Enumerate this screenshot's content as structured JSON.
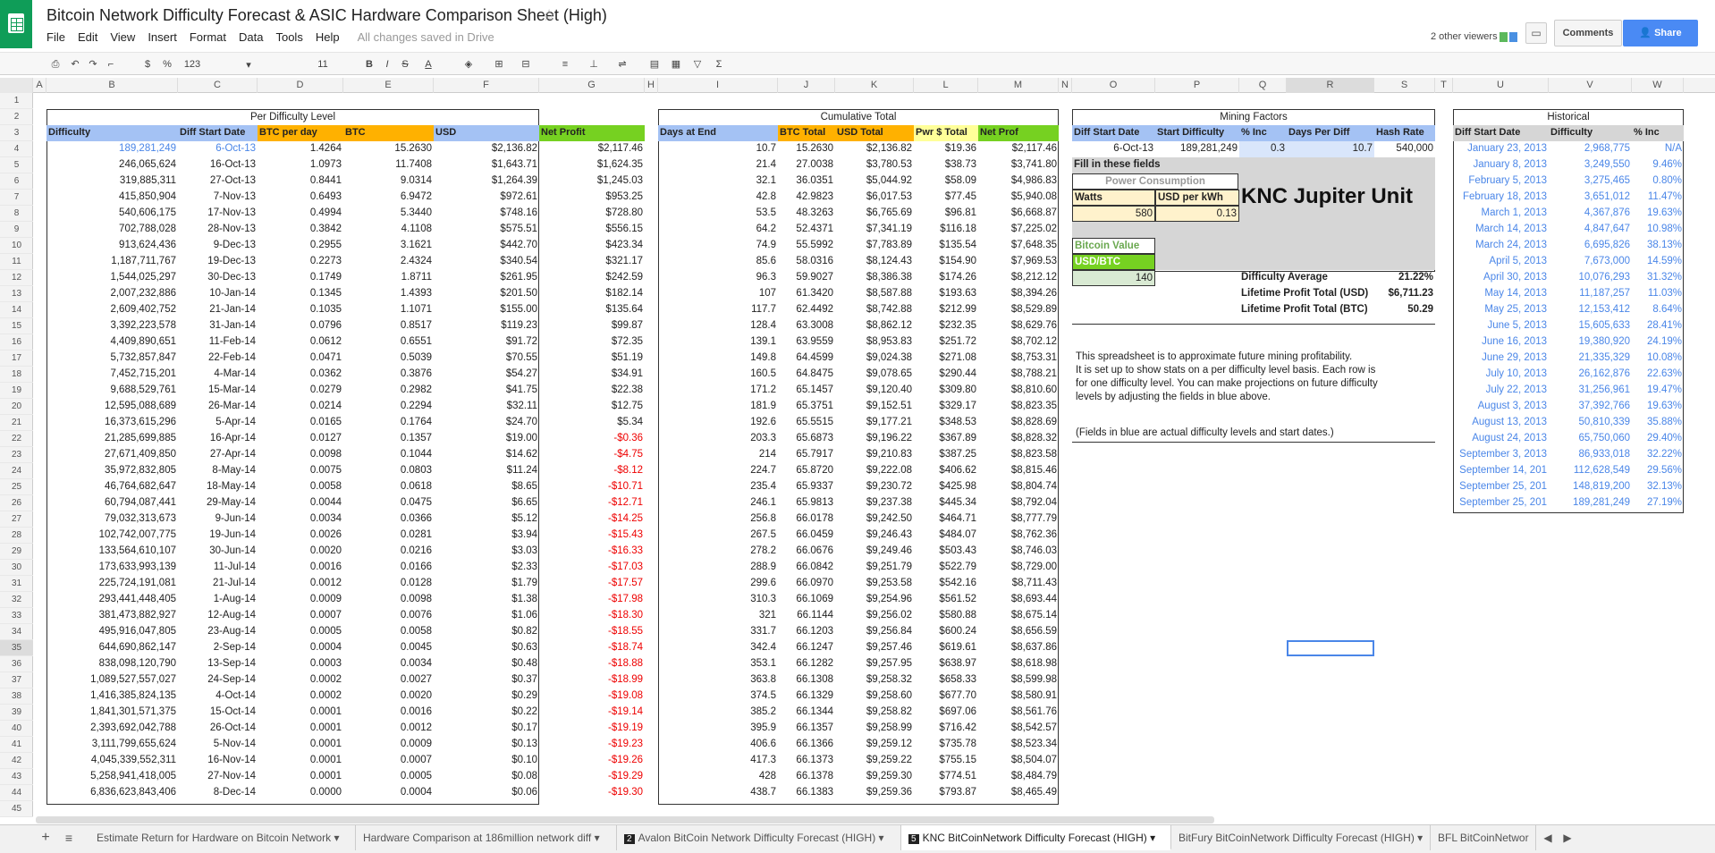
{
  "title": "Bitcoin Network Difficulty Forecast & ASIC Hardware Comparison Sheet (High)",
  "menu": [
    "File",
    "Edit",
    "View",
    "Insert",
    "Format",
    "Data",
    "Tools",
    "Help"
  ],
  "saved": "All changes saved in Drive",
  "viewers": "2 other viewers",
  "comments": "Comments",
  "share": "Share",
  "toolbar": {
    "currency": "$",
    "percent": "%",
    "numfmt": "123",
    "fontsize": "11"
  },
  "columns": [
    "A",
    "B",
    "C",
    "D",
    "E",
    "F",
    "G",
    "H",
    "I",
    "J",
    "K",
    "L",
    "M",
    "N",
    "O",
    "P",
    "Q",
    "R",
    "S",
    "T",
    "U",
    "V",
    "W"
  ],
  "section_titles": {
    "per": "Per Difficulty Level",
    "cum": "Cumulative Total",
    "mining": "Mining Factors",
    "hist": "Historical"
  },
  "per_headers": [
    "Difficulty",
    "Diff Start Date",
    "BTC per day",
    "BTC",
    "USD",
    "Net Profit"
  ],
  "cum_headers": [
    "Days at End",
    "BTC Total",
    "USD Total",
    "Pwr $ Total",
    "Net Prof"
  ],
  "rows": [
    [
      "189,281,249",
      "6-Oct-13",
      "1.4264",
      "15.2630",
      "$2,136.82",
      "$2,117.46",
      "10.7",
      "15.2630",
      "$2,136.82",
      "$19.36",
      "$2,117.46"
    ],
    [
      "246,065,624",
      "16-Oct-13",
      "1.0973",
      "11.7408",
      "$1,643.71",
      "$1,624.35",
      "21.4",
      "27.0038",
      "$3,780.53",
      "$38.73",
      "$3,741.80"
    ],
    [
      "319,885,311",
      "27-Oct-13",
      "0.8441",
      "9.0314",
      "$1,264.39",
      "$1,245.03",
      "32.1",
      "36.0351",
      "$5,044.92",
      "$58.09",
      "$4,986.83"
    ],
    [
      "415,850,904",
      "7-Nov-13",
      "0.6493",
      "6.9472",
      "$972.61",
      "$953.25",
      "42.8",
      "42.9823",
      "$6,017.53",
      "$77.45",
      "$5,940.08"
    ],
    [
      "540,606,175",
      "17-Nov-13",
      "0.4994",
      "5.3440",
      "$748.16",
      "$728.80",
      "53.5",
      "48.3263",
      "$6,765.69",
      "$96.81",
      "$6,668.87"
    ],
    [
      "702,788,028",
      "28-Nov-13",
      "0.3842",
      "4.1108",
      "$575.51",
      "$556.15",
      "64.2",
      "52.4371",
      "$7,341.19",
      "$116.18",
      "$7,225.02"
    ],
    [
      "913,624,436",
      "9-Dec-13",
      "0.2955",
      "3.1621",
      "$442.70",
      "$423.34",
      "74.9",
      "55.5992",
      "$7,783.89",
      "$135.54",
      "$7,648.35"
    ],
    [
      "1,187,711,767",
      "19-Dec-13",
      "0.2273",
      "2.4324",
      "$340.54",
      "$321.17",
      "85.6",
      "58.0316",
      "$8,124.43",
      "$154.90",
      "$7,969.53"
    ],
    [
      "1,544,025,297",
      "30-Dec-13",
      "0.1749",
      "1.8711",
      "$261.95",
      "$242.59",
      "96.3",
      "59.9027",
      "$8,386.38",
      "$174.26",
      "$8,212.12"
    ],
    [
      "2,007,232,886",
      "10-Jan-14",
      "0.1345",
      "1.4393",
      "$201.50",
      "$182.14",
      "107",
      "61.3420",
      "$8,587.88",
      "$193.63",
      "$8,394.26"
    ],
    [
      "2,609,402,752",
      "21-Jan-14",
      "0.1035",
      "1.1071",
      "$155.00",
      "$135.64",
      "117.7",
      "62.4492",
      "$8,742.88",
      "$212.99",
      "$8,529.89"
    ],
    [
      "3,392,223,578",
      "31-Jan-14",
      "0.0796",
      "0.8517",
      "$119.23",
      "$99.87",
      "128.4",
      "63.3008",
      "$8,862.12",
      "$232.35",
      "$8,629.76"
    ],
    [
      "4,409,890,651",
      "11-Feb-14",
      "0.0612",
      "0.6551",
      "$91.72",
      "$72.35",
      "139.1",
      "63.9559",
      "$8,953.83",
      "$251.72",
      "$8,702.12"
    ],
    [
      "5,732,857,847",
      "22-Feb-14",
      "0.0471",
      "0.5039",
      "$70.55",
      "$51.19",
      "149.8",
      "64.4599",
      "$9,024.38",
      "$271.08",
      "$8,753.31"
    ],
    [
      "7,452,715,201",
      "4-Mar-14",
      "0.0362",
      "0.3876",
      "$54.27",
      "$34.91",
      "160.5",
      "64.8475",
      "$9,078.65",
      "$290.44",
      "$8,788.21"
    ],
    [
      "9,688,529,761",
      "15-Mar-14",
      "0.0279",
      "0.2982",
      "$41.75",
      "$22.38",
      "171.2",
      "65.1457",
      "$9,120.40",
      "$309.80",
      "$8,810.60"
    ],
    [
      "12,595,088,689",
      "26-Mar-14",
      "0.0214",
      "0.2294",
      "$32.11",
      "$12.75",
      "181.9",
      "65.3751",
      "$9,152.51",
      "$329.17",
      "$8,823.35"
    ],
    [
      "16,373,615,296",
      "5-Apr-14",
      "0.0165",
      "0.1764",
      "$24.70",
      "$5.34",
      "192.6",
      "65.5515",
      "$9,177.21",
      "$348.53",
      "$8,828.69"
    ],
    [
      "21,285,699,885",
      "16-Apr-14",
      "0.0127",
      "0.1357",
      "$19.00",
      "-$0.36",
      "203.3",
      "65.6873",
      "$9,196.22",
      "$367.89",
      "$8,828.32"
    ],
    [
      "27,671,409,850",
      "27-Apr-14",
      "0.0098",
      "0.1044",
      "$14.62",
      "-$4.75",
      "214",
      "65.7917",
      "$9,210.83",
      "$387.25",
      "$8,823.58"
    ],
    [
      "35,972,832,805",
      "8-May-14",
      "0.0075",
      "0.0803",
      "$11.24",
      "-$8.12",
      "224.7",
      "65.8720",
      "$9,222.08",
      "$406.62",
      "$8,815.46"
    ],
    [
      "46,764,682,647",
      "18-May-14",
      "0.0058",
      "0.0618",
      "$8.65",
      "-$10.71",
      "235.4",
      "65.9337",
      "$9,230.72",
      "$425.98",
      "$8,804.74"
    ],
    [
      "60,794,087,441",
      "29-May-14",
      "0.0044",
      "0.0475",
      "$6.65",
      "-$12.71",
      "246.1",
      "65.9813",
      "$9,237.38",
      "$445.34",
      "$8,792.04"
    ],
    [
      "79,032,313,673",
      "9-Jun-14",
      "0.0034",
      "0.0366",
      "$5.12",
      "-$14.25",
      "256.8",
      "66.0178",
      "$9,242.50",
      "$464.71",
      "$8,777.79"
    ],
    [
      "102,742,007,775",
      "19-Jun-14",
      "0.0026",
      "0.0281",
      "$3.94",
      "-$15.43",
      "267.5",
      "66.0459",
      "$9,246.43",
      "$484.07",
      "$8,762.36"
    ],
    [
      "133,564,610,107",
      "30-Jun-14",
      "0.0020",
      "0.0216",
      "$3.03",
      "-$16.33",
      "278.2",
      "66.0676",
      "$9,249.46",
      "$503.43",
      "$8,746.03"
    ],
    [
      "173,633,993,139",
      "11-Jul-14",
      "0.0016",
      "0.0166",
      "$2.33",
      "-$17.03",
      "288.9",
      "66.0842",
      "$9,251.79",
      "$522.79",
      "$8,729.00"
    ],
    [
      "225,724,191,081",
      "21-Jul-14",
      "0.0012",
      "0.0128",
      "$1.79",
      "-$17.57",
      "299.6",
      "66.0970",
      "$9,253.58",
      "$542.16",
      "$8,711.43"
    ],
    [
      "293,441,448,405",
      "1-Aug-14",
      "0.0009",
      "0.0098",
      "$1.38",
      "-$17.98",
      "310.3",
      "66.1069",
      "$9,254.96",
      "$561.52",
      "$8,693.44"
    ],
    [
      "381,473,882,927",
      "12-Aug-14",
      "0.0007",
      "0.0076",
      "$1.06",
      "-$18.30",
      "321",
      "66.1144",
      "$9,256.02",
      "$580.88",
      "$8,675.14"
    ],
    [
      "495,916,047,805",
      "23-Aug-14",
      "0.0005",
      "0.0058",
      "$0.82",
      "-$18.55",
      "331.7",
      "66.1203",
      "$9,256.84",
      "$600.24",
      "$8,656.59"
    ],
    [
      "644,690,862,147",
      "2-Sep-14",
      "0.0004",
      "0.0045",
      "$0.63",
      "-$18.74",
      "342.4",
      "66.1247",
      "$9,257.46",
      "$619.61",
      "$8,637.86"
    ],
    [
      "838,098,120,790",
      "13-Sep-14",
      "0.0003",
      "0.0034",
      "$0.48",
      "-$18.88",
      "353.1",
      "66.1282",
      "$9,257.95",
      "$638.97",
      "$8,618.98"
    ],
    [
      "1,089,527,557,027",
      "24-Sep-14",
      "0.0002",
      "0.0027",
      "$0.37",
      "-$18.99",
      "363.8",
      "66.1308",
      "$9,258.32",
      "$658.33",
      "$8,599.98"
    ],
    [
      "1,416,385,824,135",
      "4-Oct-14",
      "0.0002",
      "0.0020",
      "$0.29",
      "-$19.08",
      "374.5",
      "66.1329",
      "$9,258.60",
      "$677.70",
      "$8,580.91"
    ],
    [
      "1,841,301,571,375",
      "15-Oct-14",
      "0.0001",
      "0.0016",
      "$0.22",
      "-$19.14",
      "385.2",
      "66.1344",
      "$9,258.82",
      "$697.06",
      "$8,561.76"
    ],
    [
      "2,393,692,042,788",
      "26-Oct-14",
      "0.0001",
      "0.0012",
      "$0.17",
      "-$19.19",
      "395.9",
      "66.1357",
      "$9,258.99",
      "$716.42",
      "$8,542.57"
    ],
    [
      "3,111,799,655,624",
      "5-Nov-14",
      "0.0001",
      "0.0009",
      "$0.13",
      "-$19.23",
      "406.6",
      "66.1366",
      "$9,259.12",
      "$735.78",
      "$8,523.34"
    ],
    [
      "4,045,339,552,311",
      "16-Nov-14",
      "0.0001",
      "0.0007",
      "$0.10",
      "-$19.26",
      "417.3",
      "66.1373",
      "$9,259.22",
      "$755.15",
      "$8,504.07"
    ],
    [
      "5,258,941,418,005",
      "27-Nov-14",
      "0.0001",
      "0.0005",
      "$0.08",
      "-$19.29",
      "428",
      "66.1378",
      "$9,259.30",
      "$774.51",
      "$8,484.79"
    ],
    [
      "6,836,623,843,406",
      "8-Dec-14",
      "0.0000",
      "0.0004",
      "$0.06",
      "-$19.30",
      "438.7",
      "66.1383",
      "$9,259.36",
      "$793.87",
      "$8,465.49"
    ]
  ],
  "mining": {
    "headers": [
      "Diff Start Date",
      "Start Difficulty",
      "% Inc",
      "Days Per Diff",
      "Hash Rate"
    ],
    "values": [
      "6-Oct-13",
      "189,281,249",
      "0.3",
      "10.7",
      "540,000"
    ],
    "fill": "Fill in these fields",
    "power_title": "Power Consumption",
    "watts_label": "Watts",
    "kwh_label": "USD per kWh",
    "watts": "580",
    "kwh": "0.13",
    "unit": "KNC Jupiter Unit",
    "btc_value_title": "Bitcoin Value",
    "usd_btc_label": "USD/BTC",
    "usd_btc": "140",
    "summary": [
      [
        "Difficulty Average",
        "21.22%"
      ],
      [
        "Lifetime Profit Total (USD)",
        "$6,711.23"
      ],
      [
        "Lifetime Profit Total (BTC)",
        "50.29"
      ]
    ],
    "note1": "This spreadsheet is to approximate future mining profitability.",
    "note2": "It is set up to show stats on a per difficulty level basis. Each row is",
    "note3": "for one difficulty level. You can make projections on future difficulty",
    "note4": "levels by adjusting the fields in blue above.",
    "note5": "(Fields in blue are actual difficulty levels and start dates.)"
  },
  "historical": {
    "headers": [
      "Diff Start Date",
      "Difficulty",
      "% Inc"
    ],
    "rows": [
      [
        "January 23, 2013",
        "2,968,775",
        "N/A"
      ],
      [
        "January 8, 2013",
        "3,249,550",
        "9.46%"
      ],
      [
        "February 5, 2013",
        "3,275,465",
        "0.80%"
      ],
      [
        "February 18, 2013",
        "3,651,012",
        "11.47%"
      ],
      [
        "March 1, 2013",
        "4,367,876",
        "19.63%"
      ],
      [
        "March 14, 2013",
        "4,847,647",
        "10.98%"
      ],
      [
        "March 24, 2013",
        "6,695,826",
        "38.13%"
      ],
      [
        "April 5, 2013",
        "7,673,000",
        "14.59%"
      ],
      [
        "April 30, 2013",
        "10,076,293",
        "31.32%"
      ],
      [
        "May 14, 2013",
        "11,187,257",
        "11.03%"
      ],
      [
        "May 25, 2013",
        "12,153,412",
        "8.64%"
      ],
      [
        "June 5, 2013",
        "15,605,633",
        "28.41%"
      ],
      [
        "June 16, 2013",
        "19,380,920",
        "24.19%"
      ],
      [
        "June 29, 2013",
        "21,335,329",
        "10.08%"
      ],
      [
        "July 10, 2013",
        "26,162,876",
        "22.63%"
      ],
      [
        "July 22, 2013",
        "31,256,961",
        "19.47%"
      ],
      [
        "August 3, 2013",
        "37,392,766",
        "19.63%"
      ],
      [
        "August 13, 2013",
        "50,810,339",
        "35.88%"
      ],
      [
        "August 24, 2013",
        "65,750,060",
        "29.40%"
      ],
      [
        "September 3, 2013",
        "86,933,018",
        "32.22%"
      ],
      [
        "September 14, 201",
        "112,628,549",
        "29.56%"
      ],
      [
        "September 25, 201",
        "148,819,200",
        "32.13%"
      ],
      [
        "September 25, 201",
        "189,281,249",
        "27.19%"
      ]
    ]
  },
  "tabs": [
    "Estimate Return for Hardware on Bitcoin Network",
    "Hardware Comparison at 186million network diff",
    "Avalon BitCoin Network Difficulty Forecast (HIGH)",
    "KNC BitCoinNetwork Difficulty Forecast (HIGH)",
    "BitFury BitCoinNetwork Difficulty Forecast (HIGH)",
    "BFL BitCoinNetwor"
  ],
  "tab_badges": [
    "2",
    "5"
  ]
}
